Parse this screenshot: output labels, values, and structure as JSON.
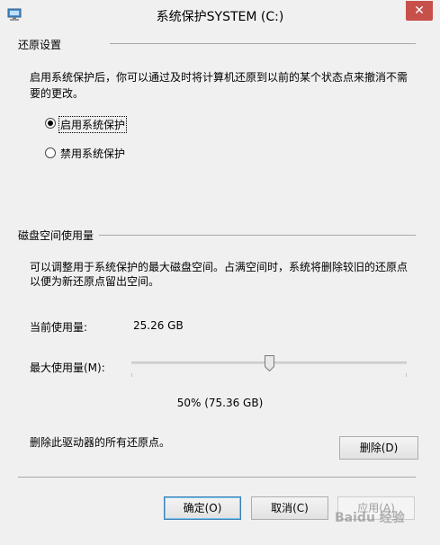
{
  "window": {
    "title": "系统保护SYSTEM (C:)",
    "close_symbol": "✕"
  },
  "restore_settings": {
    "group_title": "还原设置",
    "description_line1": "启用系统保护后，你可以通过及时将计算机还原到以前的某个状态点来撤消不需",
    "description_line2": "要的更改。",
    "option_enable": "启用系统保护",
    "option_disable": "禁用系统保护",
    "selected": "enable"
  },
  "disk_usage": {
    "group_title": "磁盘空间使用量",
    "description_line1": "可以调整用于系统保护的最大磁盘空间。占满空间时，系统将删除较旧的还原点",
    "description_line2": "以便为新还原点留出空间。",
    "current_usage_label": "当前使用量:",
    "current_usage_value": "25.26 GB",
    "max_usage_label": "最大使用量(M):",
    "max_usage_percent": 0.5,
    "max_usage_text": "50% (75.36 GB)",
    "delete_description": "删除此驱动器的所有还原点。",
    "delete_button": "删除(D)"
  },
  "footer": {
    "ok_button": "确定(O)",
    "cancel_button": "取消(C)",
    "apply_button": "应用(A)"
  },
  "watermark": "Baidu 经验"
}
